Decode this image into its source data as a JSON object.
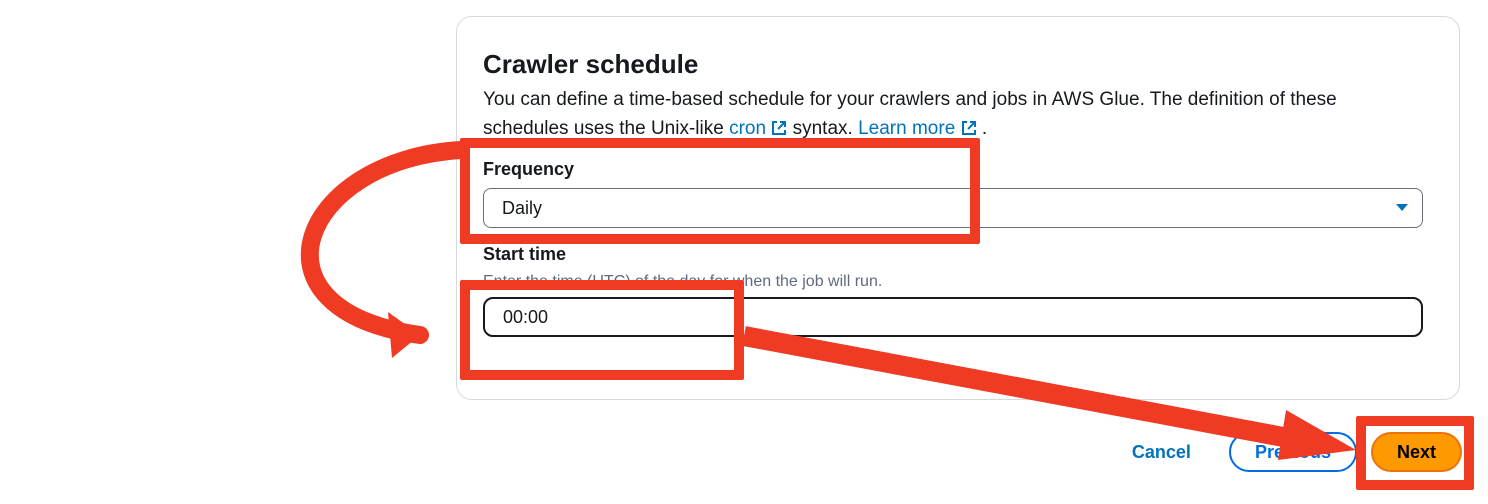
{
  "panel": {
    "title": "Crawler schedule",
    "description_start": "You can define a time-based schedule for your crawlers and jobs in AWS Glue. The definition of these schedules uses the Unix-like ",
    "cron_link": "cron",
    "description_mid": " syntax. ",
    "learn_more_link": "Learn more",
    "description_end": "."
  },
  "frequency": {
    "label": "Frequency",
    "value": "Daily"
  },
  "start_time": {
    "label": "Start time",
    "help": "Enter the time (UTC) of the day for when the job will run.",
    "value": "00:00"
  },
  "footer": {
    "cancel": "Cancel",
    "previous": "Previous",
    "next": "Next"
  }
}
